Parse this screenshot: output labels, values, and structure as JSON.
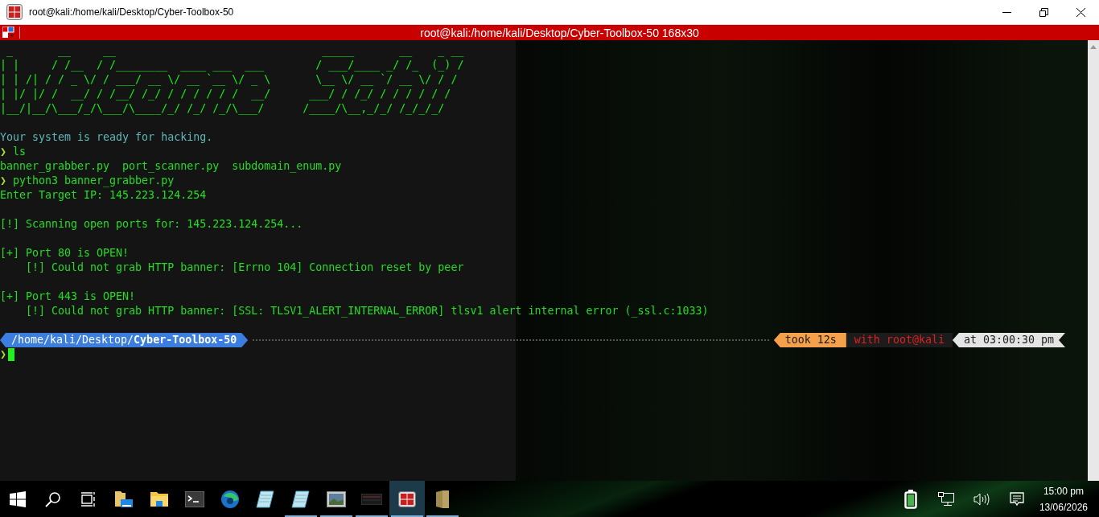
{
  "window": {
    "title": "root@kali:/home/kali/Desktop/Cyber-Toolbox-50"
  },
  "terminal": {
    "title": "root@kali:/home/kali/Desktop/Cyber-Toolbox-50 168x30",
    "lines": [
      {
        "kind": "ascii",
        "text": " _       __     __                                _____       __    _ __"
      },
      {
        "kind": "ascii",
        "text": "| |     / /__  / /________  ____ ___  ___        / ___/____ _/ /_  (_) /"
      },
      {
        "kind": "ascii",
        "text": "| | /| / / _ \\/ / ___/ __ \\/ __ `__ \\/ _ \\       \\__ \\/ __ `/ __ \\/ / /"
      },
      {
        "kind": "ascii",
        "text": "| |/ |/ /  __/ / /__/ /_/ / / / / / /  __/      ___/ / /_/ / / / / / /"
      },
      {
        "kind": "ascii",
        "text": "|__/|__/\\___/_/\\___/\\____/_/ /_/ /_/\\___/      /____/\\__,_/_/ /_/_/_/"
      },
      {
        "kind": "blank"
      },
      {
        "kind": "info",
        "text": "Your system is ready for hacking."
      },
      {
        "kind": "prompt",
        "symbol": "❯",
        "text": "ls"
      },
      {
        "kind": "output",
        "text": "banner_grabber.py  port_scanner.py  subdomain_enum.py"
      },
      {
        "kind": "prompt",
        "symbol": "❯",
        "text": "python3 banner_grabber.py"
      },
      {
        "kind": "output",
        "text": "Enter Target IP: 145.223.124.254"
      },
      {
        "kind": "blank"
      },
      {
        "kind": "output",
        "text": "[!] Scanning open ports for: 145.223.124.254..."
      },
      {
        "kind": "blank"
      },
      {
        "kind": "output",
        "text": "[+] Port 80 is OPEN!"
      },
      {
        "kind": "output",
        "text": "    [!] Could not grab HTTP banner: [Errno 104] Connection reset by peer"
      },
      {
        "kind": "blank"
      },
      {
        "kind": "output",
        "text": "[+] Port 443 is OPEN!"
      },
      {
        "kind": "output",
        "text": "    [!] Could not grab HTTP banner: [SSL: TLSV1_ALERT_INTERNAL_ERROR] tlsv1 alert internal error (_ssl.c:1033)"
      },
      {
        "kind": "blank"
      },
      {
        "kind": "powerline",
        "path": "/home/kali/Desktop/**Cyber-Toolbox-50**",
        "duration": "took 12s",
        "user": "with root@kali",
        "time": "at 03:00:30 pm"
      },
      {
        "kind": "cursor",
        "symbol": "❯"
      }
    ]
  },
  "taskbar": {
    "items": [
      {
        "kind": "start",
        "running": false,
        "active": false
      },
      {
        "kind": "search",
        "running": false,
        "active": false
      },
      {
        "kind": "taskview",
        "running": false,
        "active": false
      },
      {
        "kind": "explorer",
        "running": false,
        "active": false
      },
      {
        "kind": "folder",
        "running": false,
        "active": false
      },
      {
        "kind": "terminal",
        "running": false,
        "active": false
      },
      {
        "kind": "browser",
        "running": false,
        "active": false
      },
      {
        "kind": "notepad",
        "running": false,
        "active": false
      },
      {
        "kind": "notepad",
        "running": true,
        "active": false
      },
      {
        "kind": "picture",
        "running": true,
        "active": false
      },
      {
        "kind": "darkwindow",
        "running": true,
        "active": false
      },
      {
        "kind": "redapp",
        "running": true,
        "active": true
      },
      {
        "kind": "tanfolder",
        "running": true,
        "active": false
      }
    ],
    "clock": {
      "time": "15:00 pm",
      "date": "13/06/2026"
    }
  }
}
